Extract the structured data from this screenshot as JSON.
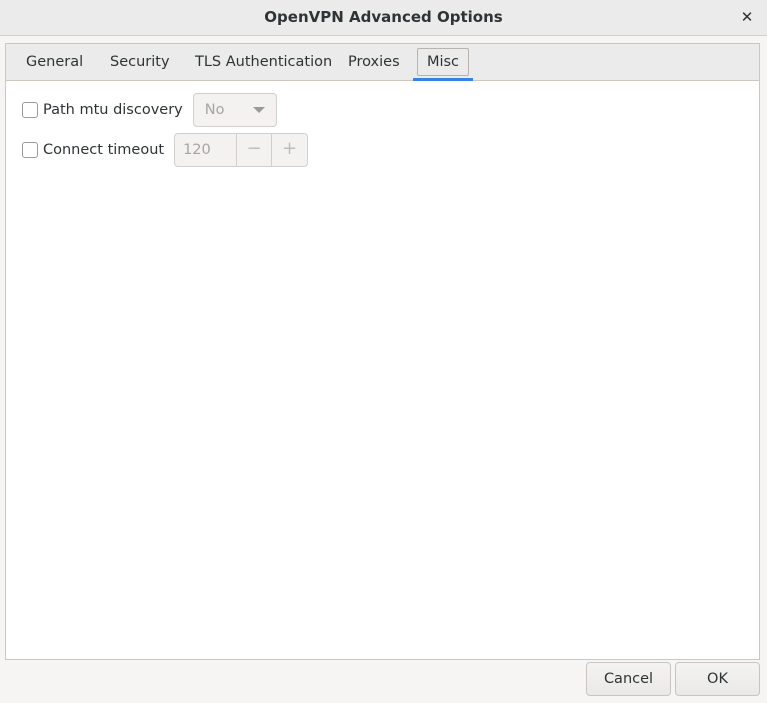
{
  "window": {
    "title": "OpenVPN Advanced Options",
    "close_glyph": "✕"
  },
  "tabs": [
    {
      "label": "General"
    },
    {
      "label": "Security"
    },
    {
      "label": "TLS Authentication"
    },
    {
      "label": "Proxies"
    },
    {
      "label": "Misc",
      "active": true
    }
  ],
  "misc": {
    "path_mtu": {
      "label": "Path mtu discovery",
      "checked": false,
      "value": "No"
    },
    "connect_timeout": {
      "label": "Connect timeout",
      "checked": false,
      "value": "120",
      "minus": "−",
      "plus": "+"
    }
  },
  "buttons": {
    "cancel": "Cancel",
    "ok": "OK"
  },
  "colors": {
    "accent": "#3584e4"
  }
}
